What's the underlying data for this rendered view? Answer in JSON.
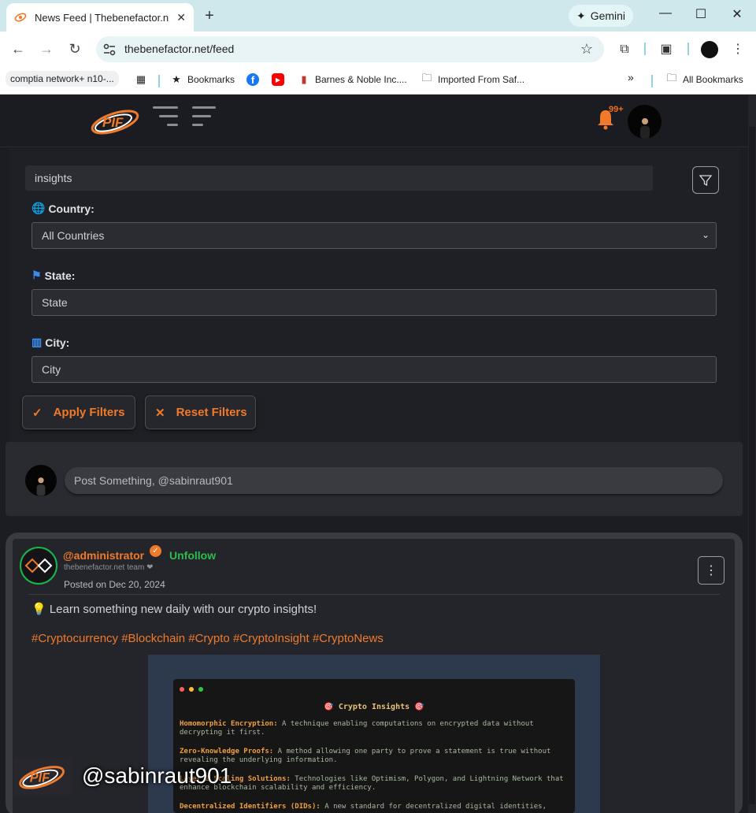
{
  "browser": {
    "tab_title": "News Feed | Thebenefactor.net",
    "tab_close": "✕",
    "new_tab": "+",
    "gemini_label": "Gemini",
    "url": "thebenefactor.net/feed",
    "bookmarks": [
      {
        "label": "comptia network+ n10-..."
      },
      {
        "label": "Bookmarks"
      },
      {
        "label": "Barnes & Noble Inc...."
      },
      {
        "label": "Imported From Saf..."
      },
      {
        "label": "All Bookmarks"
      }
    ],
    "overflow_label": "»"
  },
  "header": {
    "logo_text": "PIF",
    "notification_count": "99+"
  },
  "filters": {
    "search_value": "insights",
    "country_label": "Country:",
    "country_value": "All Countries",
    "state_label": "State:",
    "state_placeholder": "State",
    "city_label": "City:",
    "city_placeholder": "City",
    "apply_label": "Apply Filters",
    "reset_label": "Reset Filters"
  },
  "composer": {
    "placeholder": "Post Something, @sabinraut901"
  },
  "post": {
    "username": "@administrator",
    "verified_mark": "✓",
    "follow_label": "Unfollow",
    "team": "thebenefactor.net team ❤",
    "posted": "Posted on Dec 20, 2024",
    "text": "💡 Learn something new daily with our crypto insights!",
    "hashtags": "#Cryptocurrency #Blockchain #Crypto #CryptoInsight #CryptoNews",
    "more_label": "⋮",
    "image": {
      "title": "🎯 Crypto Insights 🎯",
      "lines": [
        {
          "term": "Homomorphic Encryption:",
          "text": " A technique enabling computations on encrypted data without decrypting it first."
        },
        {
          "term": "Zero-Knowledge Proofs:",
          "text": " A method allowing one party to prove a statement is true without revealing the underlying information."
        },
        {
          "term": "Layer 2 Scaling Solutions:",
          "text": " Technologies like Optimism, Polygon, and Lightning Network that enhance blockchain scalability and efficiency."
        },
        {
          "term": "Decentralized Identifiers (DIDs):",
          "text": " A new standard for decentralized digital identities,"
        }
      ]
    }
  },
  "watermark": {
    "logo_text": "PIF",
    "handle": "@sabinraut901"
  },
  "colors": {
    "accent": "#f07a2a",
    "follow_green": "#2ebd4a",
    "background": "#1c1d22"
  }
}
